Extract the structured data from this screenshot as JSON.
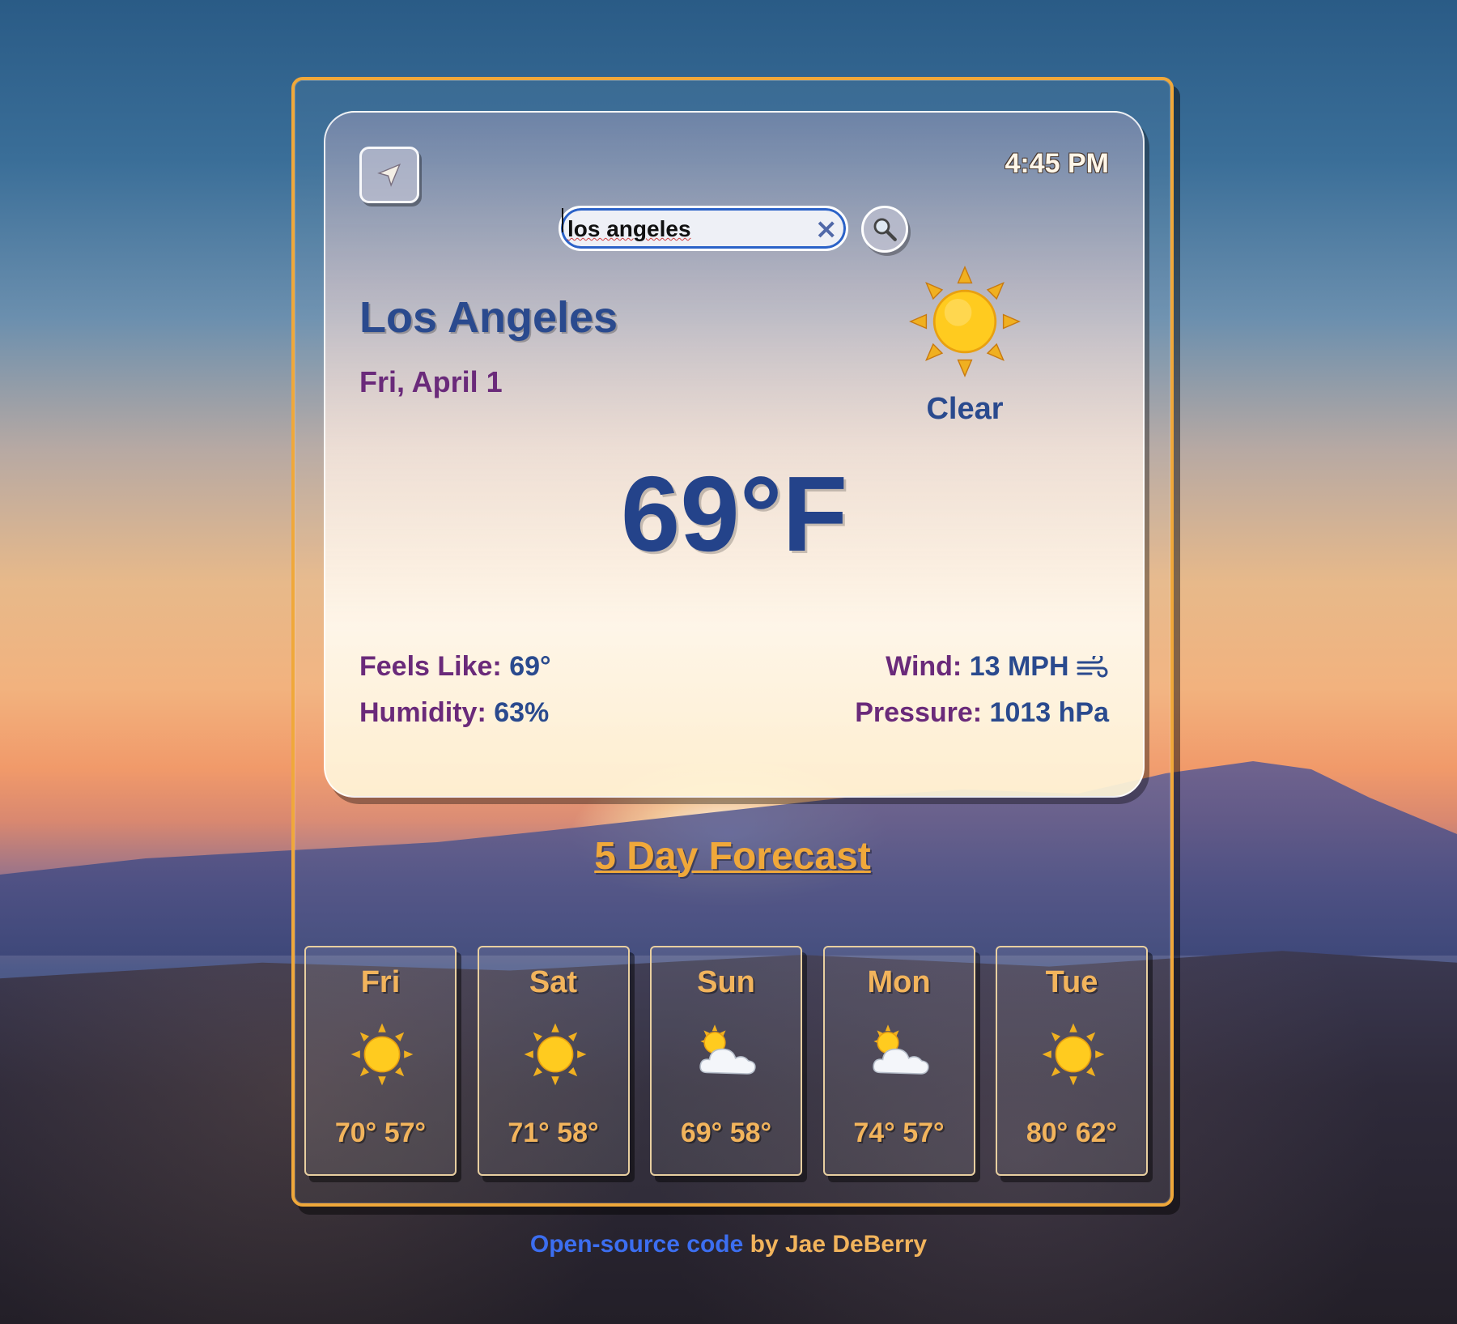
{
  "header": {
    "time": "4:45 PM"
  },
  "search": {
    "value": "los angeles"
  },
  "current": {
    "city": "Los Angeles",
    "date": "Fri, April 1",
    "condition": "Clear",
    "temperature": "69°F",
    "feels_like_label": "Feels Like:",
    "feels_like_value": "69°",
    "humidity_label": "Humidity:",
    "humidity_value": "63%",
    "wind_label": "Wind:",
    "wind_value": "13 MPH",
    "pressure_label": "Pressure:",
    "pressure_value": "1013 hPa"
  },
  "forecast": {
    "title": "5 Day Forecast",
    "days": [
      {
        "name": "Fri",
        "icon": "sun-icon",
        "temps": "70° 57°"
      },
      {
        "name": "Sat",
        "icon": "sun-icon",
        "temps": "71° 58°"
      },
      {
        "name": "Sun",
        "icon": "sun-behind-cloud-icon",
        "temps": "69° 58°"
      },
      {
        "name": "Mon",
        "icon": "sun-behind-cloud-icon",
        "temps": "74° 57°"
      },
      {
        "name": "Tue",
        "icon": "sun-icon",
        "temps": "80° 62°"
      }
    ]
  },
  "footer": {
    "link_text": "Open-source code",
    "by_text": "by Jae DeBerry"
  },
  "colors": {
    "accent": "#f0a83a",
    "city": "#2a4a8e",
    "label": "#6a2a7a",
    "link": "#3c6ef0"
  }
}
